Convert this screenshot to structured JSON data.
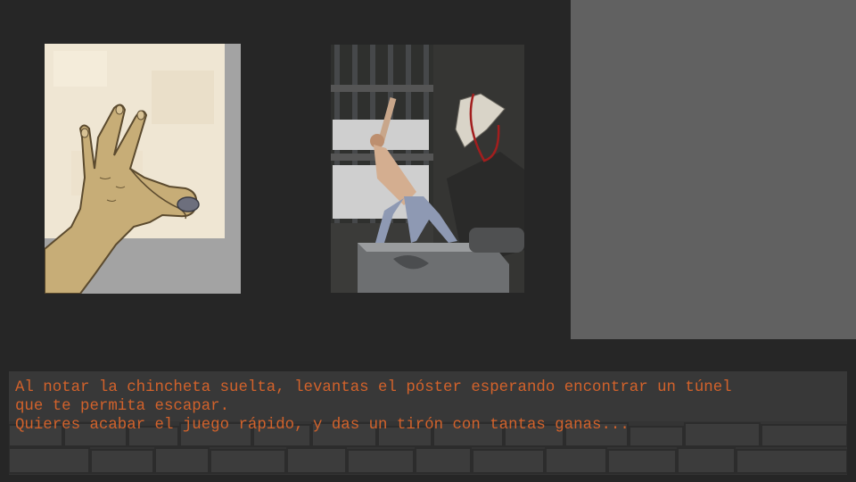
{
  "scene": {
    "panels": [
      {
        "id": "hand-pinching-thumbtack",
        "description_icon": "hand-icon"
      },
      {
        "id": "man-pulling-poster",
        "description_icon": "figure-icon"
      },
      {
        "id": "empty-panel"
      }
    ]
  },
  "dialog": {
    "line1": "Al notar la chincheta suelta, levantas el póster esperando encontrar un túnel\nque te permita escapar.",
    "line2": "Quieres acabar el juego rápido, y das un tirón con tantas ganas..."
  },
  "colors": {
    "background": "#262626",
    "text": "#d2622b",
    "dialog_bg": "#343434",
    "right_panel": "#616161"
  }
}
